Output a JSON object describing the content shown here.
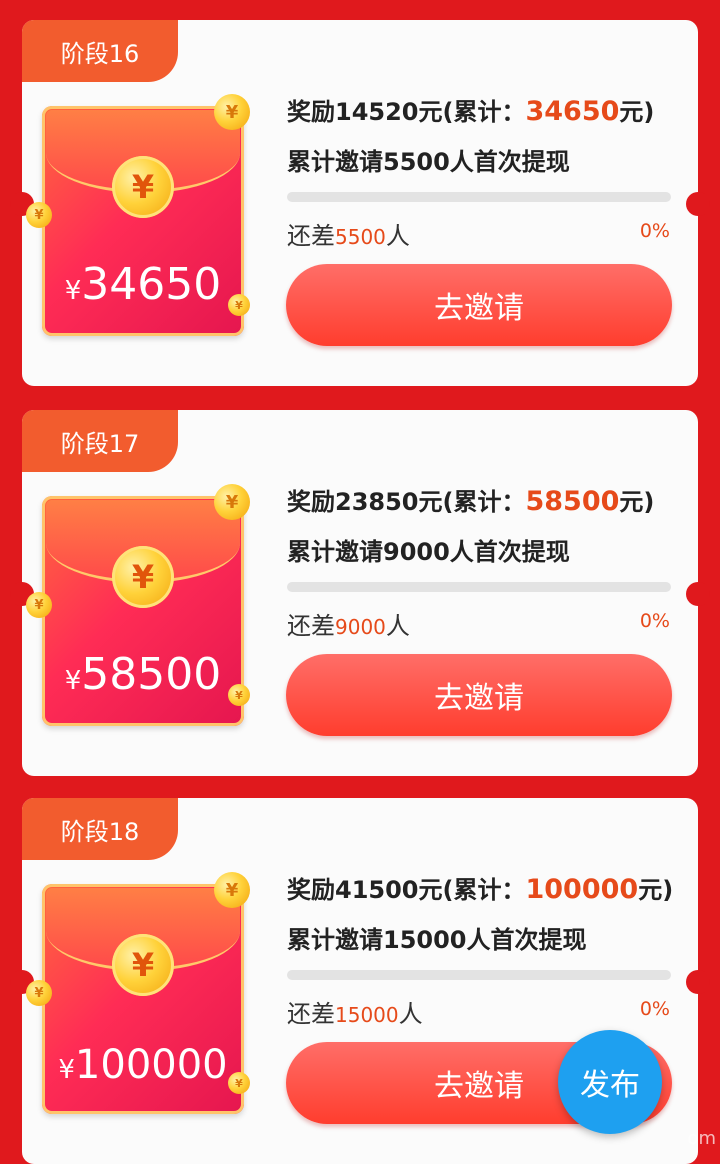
{
  "colors": {
    "background": "#e0191d",
    "accent": "#e64a1a",
    "button": "#ff4a3a",
    "fab": "#1ea0f0"
  },
  "stages": [
    {
      "label": "阶段16",
      "envelope_amount": "34650",
      "reward_prefix": "奖励14520元(累计：",
      "cumulative": "34650",
      "reward_suffix": "元)",
      "condition": "累计邀请5500人首次提现",
      "remaining_prefix": "还差",
      "remaining_count": "5500",
      "remaining_suffix": "人",
      "percent": "0%",
      "progress": 0,
      "button_label": "去邀请"
    },
    {
      "label": "阶段17",
      "envelope_amount": "58500",
      "reward_prefix": "奖励23850元(累计：",
      "cumulative": "58500",
      "reward_suffix": "元)",
      "condition": "累计邀请9000人首次提现",
      "remaining_prefix": "还差",
      "remaining_count": "9000",
      "remaining_suffix": "人",
      "percent": "0%",
      "progress": 0,
      "button_label": "去邀请"
    },
    {
      "label": "阶段18",
      "envelope_amount": "100000",
      "reward_prefix": "奖励41500元(累计：",
      "cumulative": "100000",
      "reward_suffix": "元)",
      "condition": "累计邀请15000人首次提现",
      "remaining_prefix": "还差",
      "remaining_count": "15000",
      "remaining_suffix": "人",
      "percent": "0%",
      "progress": 0,
      "button_label": "去邀请"
    }
  ],
  "currency_symbol": "¥",
  "fab_label": "发布",
  "watermark": "om"
}
